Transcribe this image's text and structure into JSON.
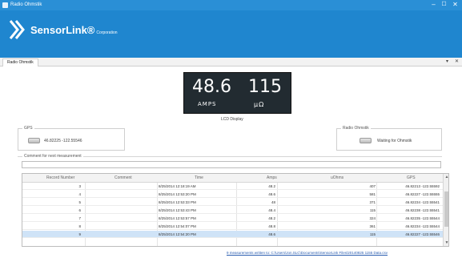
{
  "window": {
    "title": "Radio Ohmstik"
  },
  "banner": {
    "brand": "SensorLink",
    "brand_suffix": "Corporation",
    "brand_tm": "®"
  },
  "tabs": [
    {
      "label": "Radio Ohmstik"
    }
  ],
  "lcd": {
    "amps_value": "48.6",
    "amps_unit": "AMPS",
    "ohms_value": "115",
    "ohms_unit": "μΩ",
    "caption": "LCD Display"
  },
  "gps": {
    "legend": "GPS",
    "value": "46.82225 -122.55546"
  },
  "radio": {
    "legend": "Radio Ohmstik",
    "status": "Waiting for Ohmstik"
  },
  "comment": {
    "label": "Comment for next measurement",
    "value": ""
  },
  "table": {
    "columns": [
      "Record Number",
      "Comment",
      "Time",
      "Amps",
      "uOhms",
      "GPS"
    ],
    "rows": [
      {
        "record": "3",
        "comment": "",
        "time": "8/25/2014 12:18:19 AM",
        "amps": "48.2",
        "ohms": "407",
        "gps": "46.82213 -122.55592"
      },
      {
        "record": "4",
        "comment": "",
        "time": "8/25/2014 12:53:20 PM",
        "amps": "48.6",
        "ohms": "581",
        "gps": "46.82227 -122.55555"
      },
      {
        "record": "5",
        "comment": "",
        "time": "8/25/2014 12:53:33 PM",
        "amps": "48",
        "ohms": "371",
        "gps": "46.82234 -122.55541"
      },
      {
        "record": "6",
        "comment": "",
        "time": "8/25/2014 12:53:43 PM",
        "amps": "48.4",
        "ohms": "115",
        "gps": "46.82238 -122.55541"
      },
      {
        "record": "7",
        "comment": "",
        "time": "8/25/2014 12:53:57 PM",
        "amps": "48.2",
        "ohms": "324",
        "gps": "46.82235 -122.55544"
      },
      {
        "record": "8",
        "comment": "",
        "time": "8/25/2014 12:54:07 PM",
        "amps": "48.8",
        "ohms": "361",
        "gps": "46.82234 -122.55544"
      },
      {
        "record": "9",
        "comment": "",
        "time": "8/25/2014 12:54:20 PM",
        "amps": "48.6",
        "ohms": "115",
        "gps": "46.82227 -122.55546"
      }
    ],
    "selected_record": "9"
  },
  "status": {
    "message": "9 measurements written to: C:\\Users\\Jon.SLC\\Documents\\SensorLink Files\\20140825 1155 Data.csv"
  },
  "colors": {
    "titlebar": "#2a8fd6",
    "banner": "#1f86cf",
    "lcd_bg": "#222b31",
    "selected_row": "#cfe3f7"
  }
}
